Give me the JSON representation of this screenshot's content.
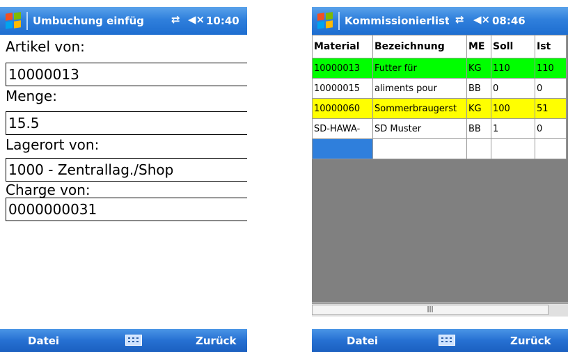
{
  "left": {
    "title": "Umbuchung einfüg",
    "clock": "10:40",
    "fields": [
      {
        "label": "Artikel von:",
        "value": "10000013"
      },
      {
        "label": "Menge:",
        "value": "15.5"
      },
      {
        "label": "Lagerort von:",
        "value": "1000 - Zentrallag./Shop"
      },
      {
        "label": "Charge von:",
        "value": "0000000031"
      }
    ],
    "softkeys": {
      "left": "Datei",
      "right": "Zurück"
    }
  },
  "right": {
    "title": "Kommissionierliste",
    "clock": "08:46",
    "columns": [
      "Material",
      "Bezeichnung",
      "ME",
      "Soll",
      "Ist"
    ],
    "rows": [
      {
        "cells": [
          "10000013",
          "Futter für",
          "KG",
          "110",
          "110"
        ],
        "color": "#00ff00"
      },
      {
        "cells": [
          "10000015",
          "aliments pour",
          "BB",
          "0",
          "0"
        ],
        "color": "#ffffff"
      },
      {
        "cells": [
          "10000060",
          "Sommerbraugerst",
          "KG",
          "100",
          "51"
        ],
        "color": "#ffff00"
      },
      {
        "cells": [
          "SD-HAWA-",
          "SD Muster",
          "BB",
          "1",
          "0"
        ],
        "color": "#ffffff"
      }
    ],
    "softkeys": {
      "left": "Datei",
      "right": "Zurück"
    }
  },
  "colors": {
    "titlebar": "#2f7fdc",
    "selected_cell": "#2f7fdc",
    "grid_empty": "#808080"
  },
  "icons": [
    "windows-start-icon",
    "connectivity-icon",
    "speaker-mute-icon",
    "keyboard-icon"
  ]
}
